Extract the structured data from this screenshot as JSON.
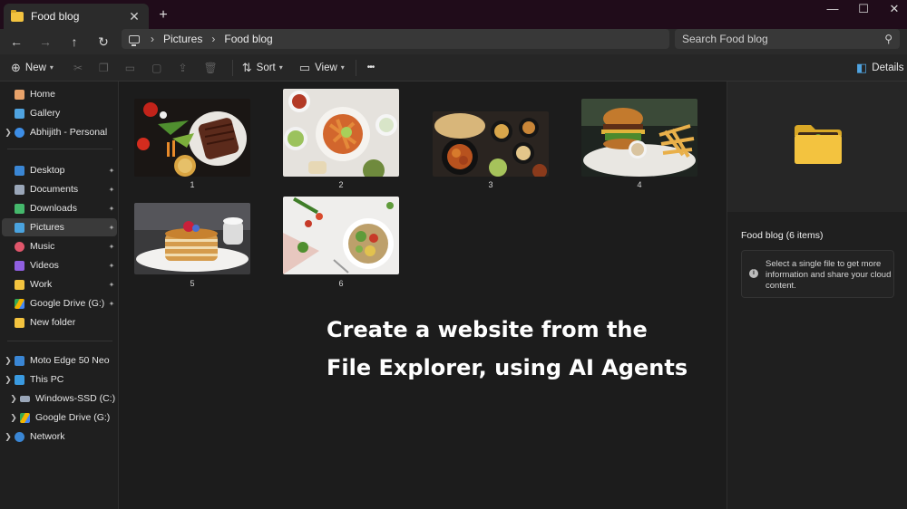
{
  "tab": {
    "title": "Food blog",
    "close": "✕",
    "new_tab": "+"
  },
  "window": {
    "minimize": "—",
    "maximize": "☐",
    "close": "✕"
  },
  "nav": {
    "back": "←",
    "forward": "→",
    "up": "↑",
    "refresh": "↻"
  },
  "breadcrumb": {
    "sep": "›",
    "items": [
      "Pictures",
      "Food blog"
    ]
  },
  "search": {
    "placeholder": "Search Food blog",
    "icon": "⚲"
  },
  "toolbar": {
    "new_label": "New",
    "sort_label": "Sort",
    "view_label": "View",
    "more_label": "•••",
    "details_label": "Details"
  },
  "sidebar": {
    "items": [
      {
        "label": "Home",
        "icon": "home-icon",
        "color": "#e8a26a"
      },
      {
        "label": "Gallery",
        "icon": "gallery-icon",
        "color": "#4fa3e0"
      },
      {
        "label": "Abhijith - Personal",
        "icon": "cloud-icon",
        "color": "#3d8ee6"
      },
      {
        "label": "Desktop",
        "icon": "desktop-icon",
        "color": "#3a86d4"
      },
      {
        "label": "Documents",
        "icon": "documents-icon",
        "color": "#9aa6b8"
      },
      {
        "label": "Downloads",
        "icon": "downloads-icon",
        "color": "#45b86c"
      },
      {
        "label": "Pictures",
        "icon": "pictures-icon",
        "color": "#4aa3df"
      },
      {
        "label": "Music",
        "icon": "music-icon",
        "color": "#e0566b"
      },
      {
        "label": "Videos",
        "icon": "videos-icon",
        "color": "#8f5fe0"
      },
      {
        "label": "Work",
        "icon": "folder-icon",
        "color": "#f3c33f"
      },
      {
        "label": "Google Drive (G:)",
        "icon": "google-drive-icon",
        "color": "#f4b400"
      },
      {
        "label": "New folder",
        "icon": "folder-icon",
        "color": "#f3c33f"
      },
      {
        "label": "Moto Edge 50 Neo",
        "icon": "phone-icon",
        "color": "#3a86d4"
      },
      {
        "label": "This PC",
        "icon": "pc-icon",
        "color": "#3a9ae0"
      },
      {
        "label": "Windows-SSD (C:)",
        "icon": "drive-icon",
        "color": "#9aa6b8"
      },
      {
        "label": "Google Drive (G:)",
        "icon": "google-drive-icon",
        "color": "#f4b400"
      },
      {
        "label": "Network",
        "icon": "network-icon",
        "color": "#3a86d4"
      }
    ],
    "pin": "📌"
  },
  "files": [
    {
      "label": "1"
    },
    {
      "label": "2"
    },
    {
      "label": "3"
    },
    {
      "label": "4"
    },
    {
      "label": "5"
    },
    {
      "label": "6"
    }
  ],
  "overlay": {
    "line1": "Create a website from the",
    "line2": "File Explorer, using AI Agents"
  },
  "details": {
    "title": "Food blog (6 items)",
    "info": "Select a single file to get more information and share your cloud content.",
    "info_icon": "i"
  },
  "colors": {
    "accent": "#f3c33f",
    "titlebar": "#200c1a"
  }
}
